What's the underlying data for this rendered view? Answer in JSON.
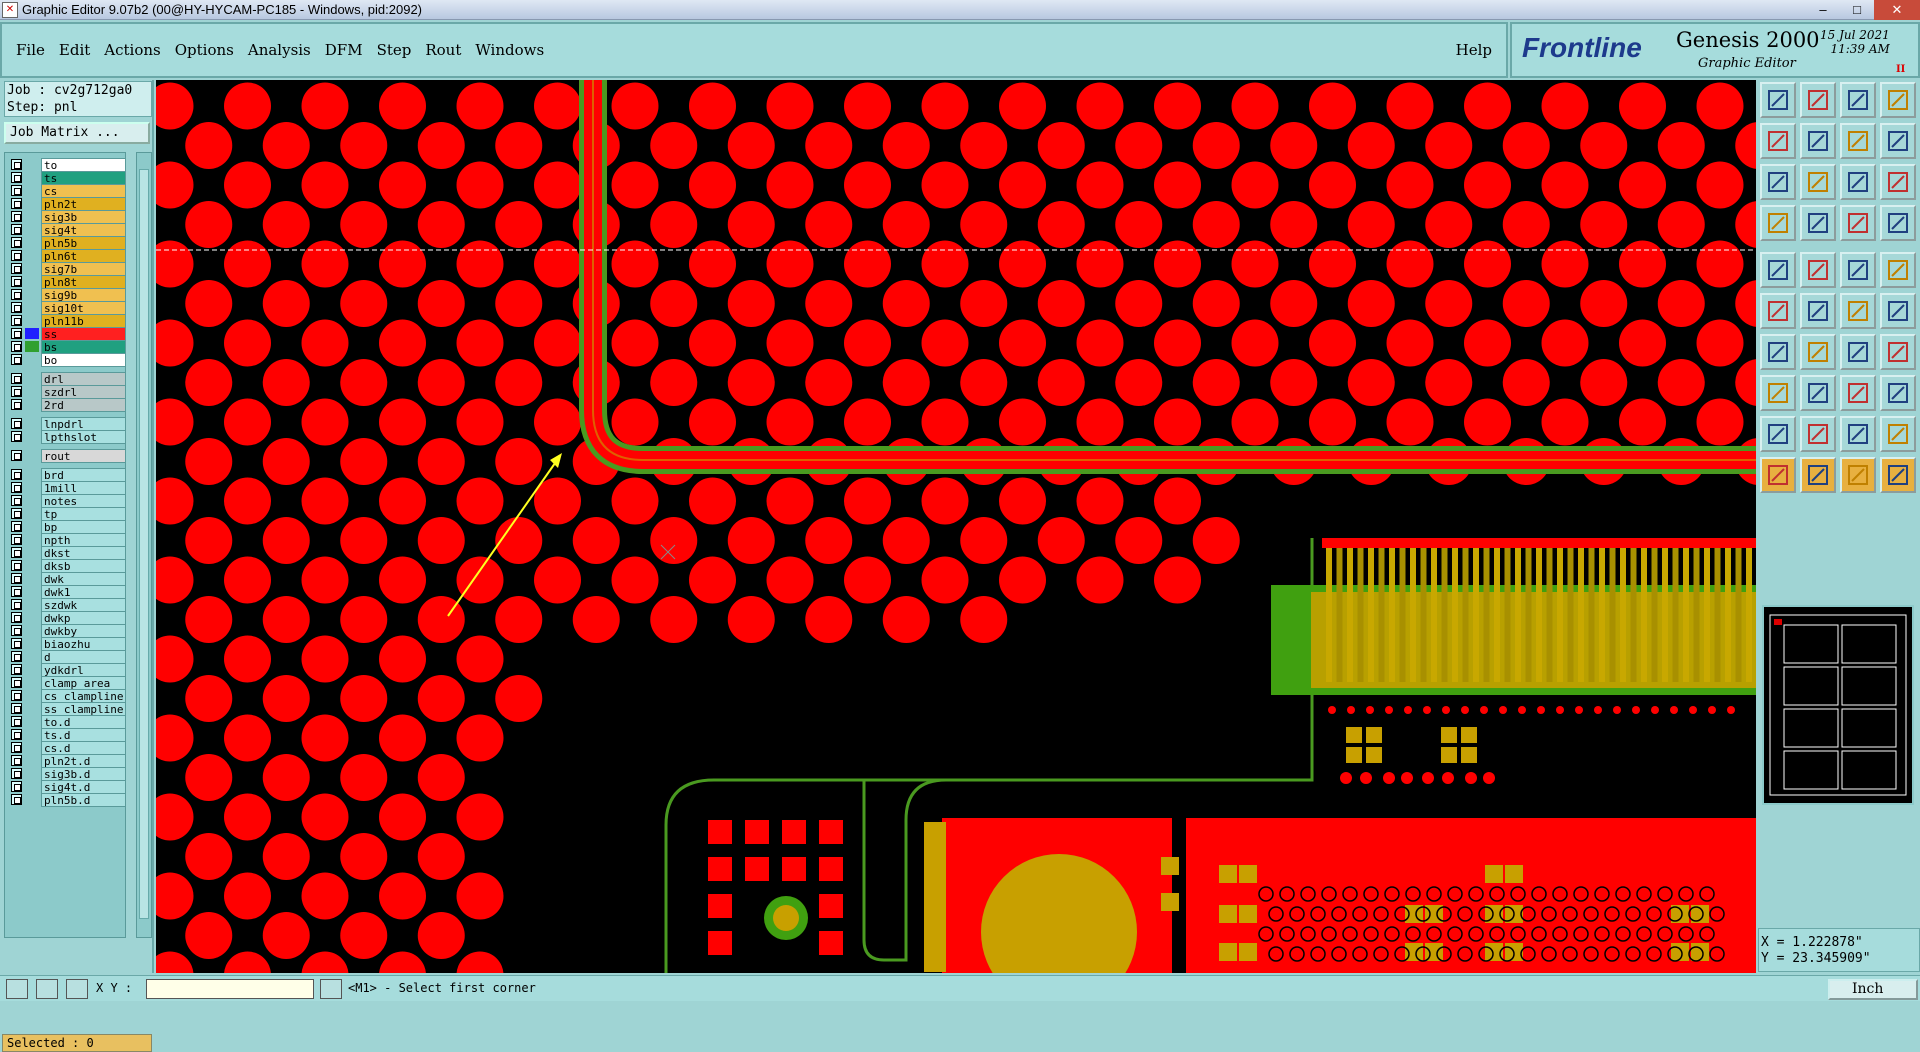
{
  "window": {
    "title": "Graphic Editor 9.07b2 (00@HY-HYCAM-PC185 - Windows, pid:2092)"
  },
  "menu": {
    "items": [
      "File",
      "Edit",
      "Actions",
      "Options",
      "Analysis",
      "DFM",
      "Step",
      "Rout",
      "Windows"
    ],
    "help": "Help"
  },
  "logo": {
    "brand": "Frontline",
    "product": "Genesis 2000",
    "subtitle": "Graphic Editor",
    "date": "15 Jul 2021",
    "time": "11:39 AM"
  },
  "job": {
    "job_line": "Job : cv2g712ga0",
    "step_line": "Step: pnl",
    "matrix_button": "Job Matrix ..."
  },
  "layers": [
    {
      "name": "to",
      "color": "#ffffff",
      "swatch": ""
    },
    {
      "name": "ts",
      "color": "#20a080",
      "swatch": ""
    },
    {
      "name": "cs",
      "color": "#f0c050",
      "swatch": ""
    },
    {
      "name": "pln2t",
      "color": "#e0b020",
      "swatch": ""
    },
    {
      "name": "sig3b",
      "color": "#f0c050",
      "swatch": ""
    },
    {
      "name": "sig4t",
      "color": "#f0c050",
      "swatch": ""
    },
    {
      "name": "pln5b",
      "color": "#e0b020",
      "swatch": ""
    },
    {
      "name": "pln6t",
      "color": "#e0b020",
      "swatch": ""
    },
    {
      "name": "sig7b",
      "color": "#f0c050",
      "swatch": ""
    },
    {
      "name": "pln8t",
      "color": "#e0b020",
      "swatch": ""
    },
    {
      "name": "sig9b",
      "color": "#f0c050",
      "swatch": ""
    },
    {
      "name": "sig10t",
      "color": "#f0c050",
      "swatch": ""
    },
    {
      "name": "pln11b",
      "color": "#e0b020",
      "swatch": ""
    },
    {
      "name": "ss",
      "color": "#ff2020",
      "swatch": "#2020ff"
    },
    {
      "name": "bs",
      "color": "#20a080",
      "swatch": "#30a030"
    },
    {
      "name": "bo",
      "color": "#ffffff",
      "swatch": ""
    },
    {
      "name": "drl",
      "color": "#b8c8c8",
      "swatch": ""
    },
    {
      "name": "szdrl",
      "color": "#b8c8c8",
      "swatch": ""
    },
    {
      "name": "2rd",
      "color": "#b8c8c8",
      "swatch": ""
    },
    {
      "name": "lnpdrl",
      "color": "#a8e0e0",
      "swatch": ""
    },
    {
      "name": "lpthslot",
      "color": "#a8e0e0",
      "swatch": ""
    },
    {
      "name": "rout",
      "color": "#d8d8d8",
      "swatch": ""
    },
    {
      "name": "brd",
      "color": "#a8e0e0",
      "swatch": ""
    },
    {
      "name": "1mill",
      "color": "#a8e0e0",
      "swatch": ""
    },
    {
      "name": "notes",
      "color": "#a8e0e0",
      "swatch": ""
    },
    {
      "name": "tp",
      "color": "#a8e0e0",
      "swatch": ""
    },
    {
      "name": "bp",
      "color": "#a8e0e0",
      "swatch": ""
    },
    {
      "name": "npth",
      "color": "#a8e0e0",
      "swatch": ""
    },
    {
      "name": "dkst",
      "color": "#a8e0e0",
      "swatch": ""
    },
    {
      "name": "dksb",
      "color": "#a8e0e0",
      "swatch": ""
    },
    {
      "name": "dwk",
      "color": "#a8e0e0",
      "swatch": ""
    },
    {
      "name": "dwk1",
      "color": "#a8e0e0",
      "swatch": ""
    },
    {
      "name": "szdwk",
      "color": "#a8e0e0",
      "swatch": ""
    },
    {
      "name": "dwkp",
      "color": "#a8e0e0",
      "swatch": ""
    },
    {
      "name": "dwkby",
      "color": "#a8e0e0",
      "swatch": ""
    },
    {
      "name": "biaozhu",
      "color": "#a8e0e0",
      "swatch": ""
    },
    {
      "name": "d",
      "color": "#a8e0e0",
      "swatch": ""
    },
    {
      "name": "ydkdrl",
      "color": "#a8e0e0",
      "swatch": ""
    },
    {
      "name": "clamp_area",
      "color": "#a8e0e0",
      "swatch": ""
    },
    {
      "name": "cs_clampline",
      "color": "#a8e0e0",
      "swatch": ""
    },
    {
      "name": "ss_clampline",
      "color": "#a8e0e0",
      "swatch": ""
    },
    {
      "name": "to.d",
      "color": "#a8e0e0",
      "swatch": ""
    },
    {
      "name": "ts.d",
      "color": "#a8e0e0",
      "swatch": ""
    },
    {
      "name": "cs.d",
      "color": "#a8e0e0",
      "swatch": ""
    },
    {
      "name": "pln2t.d",
      "color": "#a8e0e0",
      "swatch": ""
    },
    {
      "name": "sig3b.d",
      "color": "#a8e0e0",
      "swatch": ""
    },
    {
      "name": "sig4t.d",
      "color": "#a8e0e0",
      "swatch": ""
    },
    {
      "name": "pln5b.d",
      "color": "#a8e0e0",
      "swatch": ""
    }
  ],
  "status": {
    "selected": "Selected : 0",
    "xy_label": "X Y :",
    "prompt": "<M1> - Select first corner",
    "units": "Inch"
  },
  "coords": {
    "x": "X = 1.222878\"",
    "y": "Y = 23.345909\""
  },
  "colors": {
    "pad_red": "#ff0000",
    "board_bg": "#000000",
    "gold": "#c8a000",
    "outline_green": "#4a9a20"
  },
  "toolbox": {
    "icons": [
      "view-home-icon",
      "view-redraw-icon",
      "view-home2-icon",
      "view-window-icon",
      "pan-left-icon",
      "pan-right-icon",
      "zoom-fit-icon",
      "zoom-area-icon",
      "zoom-in-icon",
      "zoom-out-icon",
      "zoom-1to2-icon",
      "help-query-icon",
      "measure-icon",
      "grid-icon",
      "layer-stack-icon",
      "layer-stack2-icon",
      "add-pad-icon",
      "add-shape-icon",
      "add-text-icon",
      "add-dot-icon",
      "node-icon",
      "cross-icon",
      "line-icon",
      "arc-icon",
      "draw-line-icon",
      "slash-icon",
      "rotate-icon",
      "mirror-icon",
      "move-icon",
      "minus-icon",
      "bracket-icon",
      "copy-icon",
      "polygon-icon",
      "polygon2-icon",
      "polygon3-icon",
      "polygon4-icon",
      "select-icon",
      "select-highlight-icon",
      "select-hand-icon",
      "select-multi-icon"
    ]
  }
}
